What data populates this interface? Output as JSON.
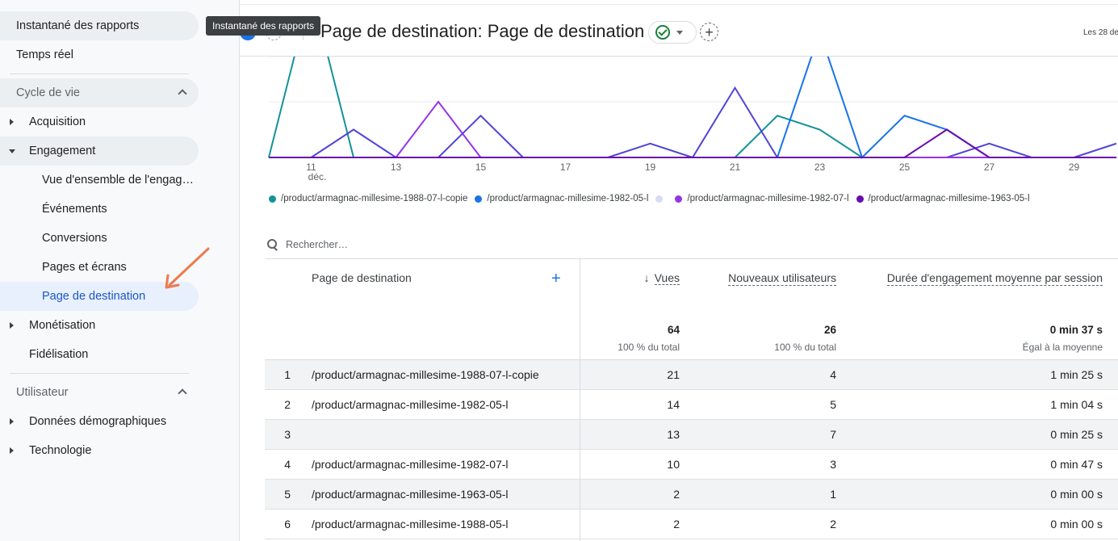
{
  "tooltip": "Instantané des rapports",
  "sidebar": {
    "top_items": [
      {
        "label": "Instantané des rapports"
      },
      {
        "label": "Temps réel"
      }
    ],
    "lifecycle": {
      "title": "Cycle de vie",
      "items": [
        {
          "label": "Acquisition"
        },
        {
          "label": "Engagement"
        },
        {
          "label": "Vue d'ensemble de l'engag…"
        },
        {
          "label": "Événements"
        },
        {
          "label": "Conversions"
        },
        {
          "label": "Pages et écrans"
        },
        {
          "label": "Page de destination"
        },
        {
          "label": "Monétisation"
        },
        {
          "label": "Fidélisation"
        }
      ]
    },
    "user": {
      "title": "Utilisateur",
      "items": [
        {
          "label": "Données démographiques"
        },
        {
          "label": "Technologie"
        }
      ]
    },
    "accent_color": "#1a56c4"
  },
  "header": {
    "title": "Page de destination: Page de destination",
    "date": "Les 28 de",
    "status_color": "#188038"
  },
  "chart_data": {
    "type": "line",
    "x": [
      "10",
      "11",
      "12",
      "13",
      "14",
      "15",
      "16",
      "17",
      "18",
      "19",
      "20",
      "21",
      "22",
      "23",
      "24",
      "25",
      "26",
      "27",
      "28",
      "29",
      "30"
    ],
    "x_tick_labels": [
      "11",
      "13",
      "15",
      "17",
      "19",
      "21",
      "23",
      "25",
      "27",
      "29"
    ],
    "x_sublabel": "déc.",
    "ylim": [
      0,
      4
    ],
    "grid": true,
    "series": [
      {
        "name": "/product/armagnac-millesime-1988-07-l-copie",
        "color": "#12939a",
        "values": [
          0,
          6,
          0,
          0,
          0,
          0,
          0,
          0,
          0,
          0,
          0,
          0,
          1.5,
          1,
          0,
          0,
          0,
          0,
          0,
          0,
          0
        ]
      },
      {
        "name": "/product/armagnac-millesime-1982-05-l",
        "color": "#1a73e8",
        "values": [
          0,
          0,
          0,
          0,
          0,
          0,
          0,
          0,
          0,
          0,
          0,
          0,
          0,
          4.5,
          0,
          1.5,
          1,
          0,
          0,
          0,
          0
        ]
      },
      {
        "name": "",
        "color": "#d6dcf5",
        "values": [
          0,
          0,
          0,
          0,
          0,
          0,
          0,
          0,
          0,
          0,
          0,
          0,
          0,
          0,
          0,
          0,
          0,
          0,
          0,
          0,
          0
        ]
      },
      {
        "name": "/product/armagnac-millesime-1982-07-l",
        "color": "#5145d6",
        "values": [
          0,
          0,
          1,
          0,
          0,
          1.5,
          0,
          0,
          0,
          0.5,
          0,
          2.5,
          0,
          0,
          0,
          0,
          0,
          0.5,
          0,
          0,
          0.5
        ]
      },
      {
        "name": "/product/armagnac-millesime-1963-05-l",
        "color": "#9334e6",
        "values": [
          0,
          0,
          0,
          0,
          2,
          0,
          0,
          0,
          0,
          0,
          0,
          0,
          0,
          0,
          0,
          0,
          0,
          0,
          0,
          0,
          0
        ]
      },
      {
        "name": "",
        "color": "#6a0dad",
        "values": [
          0,
          0,
          0,
          0,
          0,
          0,
          0,
          0,
          0,
          0,
          0,
          0,
          0,
          0,
          0,
          0,
          1,
          0,
          0,
          0,
          0
        ]
      }
    ]
  },
  "legend": [
    {
      "label": "/product/armagnac-millesime-1988-07-l-copie",
      "color": "#12939a"
    },
    {
      "label": "/product/armagnac-millesime-1982-05-l",
      "color": "#1a73e8"
    },
    {
      "label": "",
      "color": "#d6dcf5"
    },
    {
      "label": "/product/armagnac-millesime-1982-07-l",
      "color": "#9334e6"
    },
    {
      "label": "/product/armagnac-millesime-1963-05-l",
      "color": "#6a0dad"
    }
  ],
  "search": {
    "placeholder": "Rechercher…"
  },
  "table": {
    "dimension_header": "Page de destination",
    "sort_arrow": "↓",
    "columns": [
      "Vues",
      "Nouveaux utilisateurs",
      "Durée d'engagement moyenne par session"
    ],
    "totals": [
      {
        "value": "64",
        "sub": "100 % du total"
      },
      {
        "value": "26",
        "sub": "100 % du total"
      },
      {
        "value": "0 min 37 s",
        "sub": "Égal à la moyenne"
      }
    ],
    "rows": [
      {
        "idx": "1",
        "page": "/product/armagnac-millesime-1988-07-l-copie",
        "vues": "21",
        "new": "4",
        "dur": "1 min 25 s"
      },
      {
        "idx": "2",
        "page": "/product/armagnac-millesime-1982-05-l",
        "vues": "14",
        "new": "5",
        "dur": "1 min 04 s"
      },
      {
        "idx": "3",
        "page": "",
        "vues": "13",
        "new": "7",
        "dur": "0 min 25 s"
      },
      {
        "idx": "4",
        "page": "/product/armagnac-millesime-1982-07-l",
        "vues": "10",
        "new": "3",
        "dur": "0 min 47 s"
      },
      {
        "idx": "5",
        "page": "/product/armagnac-millesime-1963-05-l",
        "vues": "2",
        "new": "1",
        "dur": "0 min 00 s"
      },
      {
        "idx": "6",
        "page": "/product/armagnac-millesime-1988-05-l",
        "vues": "2",
        "new": "2",
        "dur": "0 min 00 s"
      }
    ]
  }
}
